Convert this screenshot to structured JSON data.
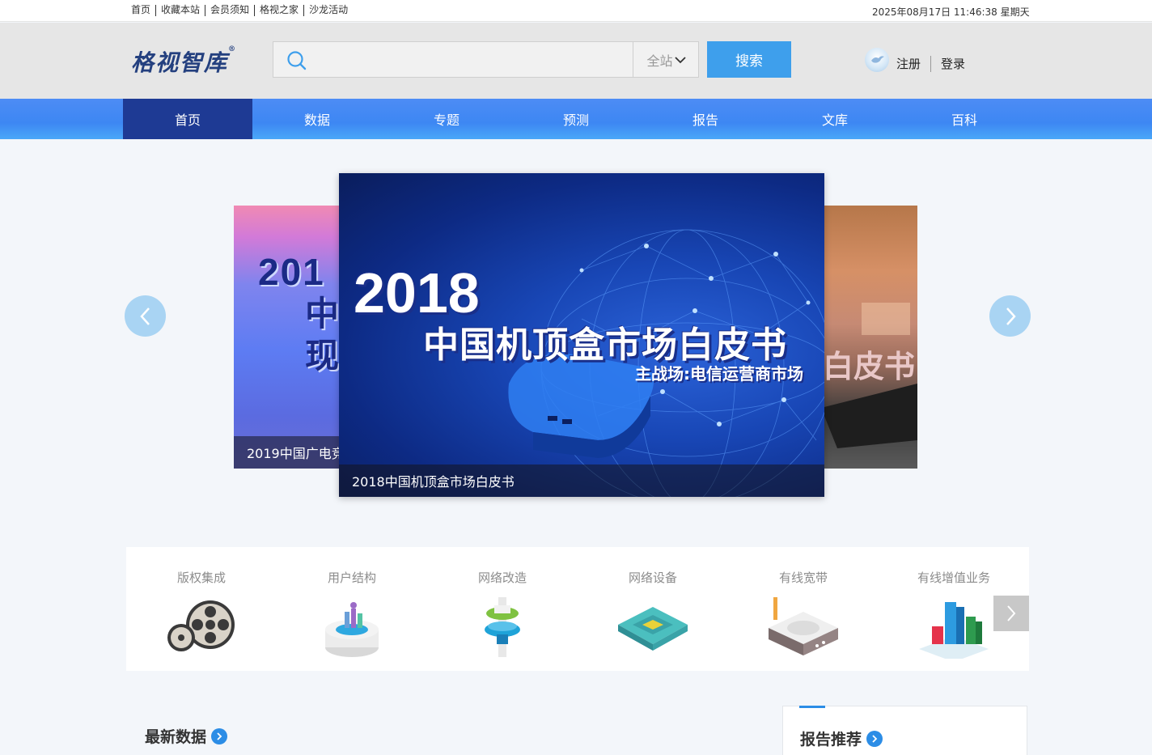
{
  "topbar": {
    "links": [
      "首页",
      "收藏本站",
      "会员须知",
      "格视之家",
      "沙龙活动"
    ],
    "datetime": "2025年08月17日 11:46:38 星期天"
  },
  "header": {
    "logo_text": "格视智库",
    "logo_mark": "®",
    "search": {
      "placeholder": "",
      "value": "",
      "scope": "全站"
    },
    "search_button": "搜索",
    "register": "注册",
    "login": "登录"
  },
  "nav": {
    "items": [
      "首页",
      "数据",
      "专题",
      "预测",
      "报告",
      "文库",
      "百科"
    ],
    "active_index": 0
  },
  "carousel": {
    "left": {
      "caption": "2019中国广电竞",
      "big": "201",
      "mid": "中\n现"
    },
    "main": {
      "caption": "2018中国机顶盒市场白皮书",
      "year": "2018",
      "title": "中国机顶盒市场白皮书",
      "subtitle": "主战场:电信运营商市场"
    },
    "right": {
      "mid": "白皮书"
    }
  },
  "categories": [
    {
      "label": "版权集成",
      "icon": "film-reel-icon"
    },
    {
      "label": "用户结构",
      "icon": "user-structure-icon"
    },
    {
      "label": "网络改造",
      "icon": "network-upgrade-icon"
    },
    {
      "label": "网络设备",
      "icon": "network-device-icon"
    },
    {
      "label": "有线宽带",
      "icon": "cable-broadband-icon"
    },
    {
      "label": "有线增值业务",
      "icon": "value-added-icon"
    }
  ],
  "sections": {
    "latest_data": "最新数据",
    "report_recommend": "报告推荐"
  },
  "colors": {
    "nav_active": "#1e3a94",
    "nav_bg": "#3d87f3",
    "search_button": "#3e9fec",
    "accent": "#2c8de6"
  }
}
